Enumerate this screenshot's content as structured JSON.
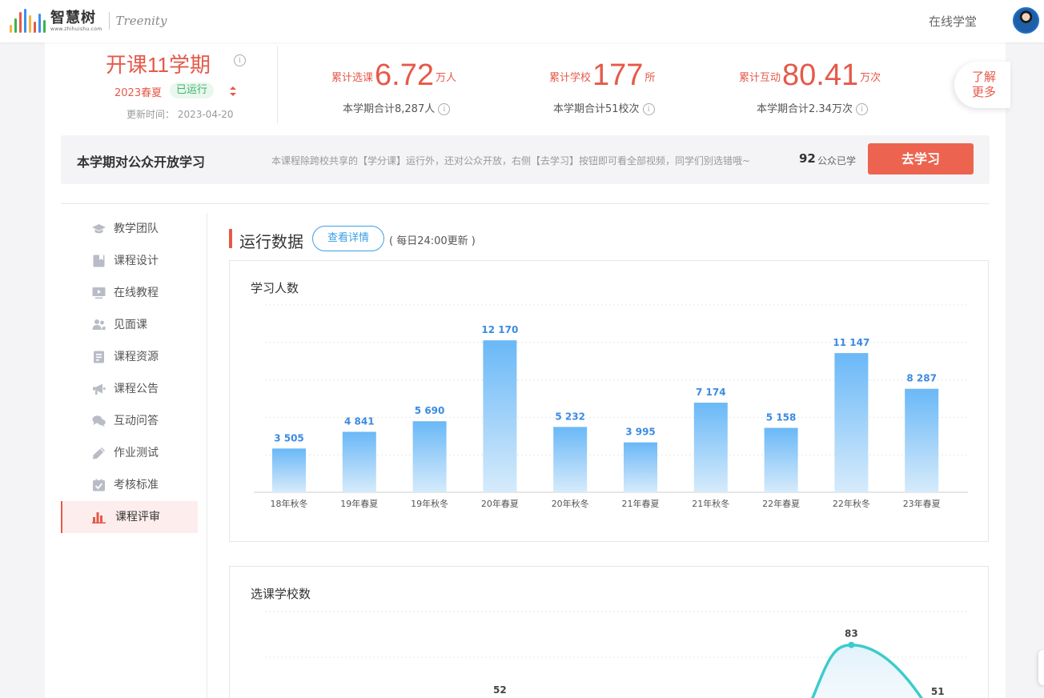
{
  "header": {
    "logo_cn": "智慧树",
    "logo_url": "www.zhihuishu.com",
    "logo_en": "Treenity",
    "nav_link": "在线学堂",
    "logo_colors": [
      "#f5b43c",
      "#39b54a",
      "#e25b4a",
      "#3e8ee8",
      "#f5b43c",
      "#e25b4a",
      "#3e8ee8",
      "#39b54a"
    ]
  },
  "summary": {
    "title": "开课11学期",
    "term": "2023春夏",
    "status": "已运行",
    "update_time": "更新时间： 2023-04-20",
    "stats": [
      {
        "label": "累计选课",
        "value": "6.72",
        "unit": "万人",
        "sub": "本学期合计8,287人"
      },
      {
        "label": "累计学校",
        "value": "177",
        "unit": "所",
        "sub": "本学期合计51校次"
      },
      {
        "label": "累计互动",
        "value": "80.41",
        "unit": "万次",
        "sub": "本学期合计2.34万次"
      }
    ],
    "more": [
      "了解",
      "更多"
    ]
  },
  "open_study": {
    "title": "本学期对公众开放学习",
    "desc": "本课程除跨校共享的【学分课】运行外，还对公众开放，右侧【去学习】按钮即可看全部视频，同学们别选错哦~",
    "count": "92",
    "count_label": "公众已学",
    "button": "去学习"
  },
  "sidebar": {
    "items": [
      {
        "label": "教学团队",
        "icon": "graduation-cap-icon"
      },
      {
        "label": "课程设计",
        "icon": "bookmark-icon"
      },
      {
        "label": "在线教程",
        "icon": "video-play-icon"
      },
      {
        "label": "见面课",
        "icon": "users-icon"
      },
      {
        "label": "课程资源",
        "icon": "document-icon"
      },
      {
        "label": "课程公告",
        "icon": "megaphone-icon"
      },
      {
        "label": "互动问答",
        "icon": "chat-bubbles-icon"
      },
      {
        "label": "作业测试",
        "icon": "pencil-icon"
      },
      {
        "label": "考核标准",
        "icon": "checklist-icon"
      },
      {
        "label": "课程评审",
        "icon": "bar-chart-icon"
      }
    ],
    "active_index": 9
  },
  "section": {
    "title": "运行数据",
    "detail_button": "查看详情",
    "note": "( 每日24:00更新 )"
  },
  "colors": {
    "accent": "#e6594a",
    "blue": "#3a9ee6",
    "line": "#3ccccc"
  },
  "chart_data": [
    {
      "type": "bar",
      "title": "学习人数",
      "categories": [
        "18年秋冬",
        "19年春夏",
        "19年秋冬",
        "20年春夏",
        "20年秋冬",
        "21年春夏",
        "21年秋冬",
        "22年春夏",
        "22年秋冬",
        "23年春夏"
      ],
      "values": [
        3505,
        4841,
        5690,
        12170,
        5232,
        3995,
        7174,
        5158,
        11147,
        8287
      ],
      "value_labels": [
        "3 505",
        "4 841",
        "5 690",
        "12 170",
        "5 232",
        "3 995",
        "7 174",
        "5 158",
        "11 147",
        "8 287"
      ],
      "ylim": [
        0,
        15000
      ],
      "grid": true,
      "legend": "none"
    },
    {
      "type": "line",
      "title": "选课学校数",
      "visible_labels": [
        {
          "category": "20年春夏",
          "value": 52,
          "label": "52"
        },
        {
          "category": "22年秋冬",
          "value": 83,
          "label": "83"
        },
        {
          "category": "23年春夏",
          "value": 51,
          "label": "51"
        }
      ],
      "grid": true
    }
  ]
}
